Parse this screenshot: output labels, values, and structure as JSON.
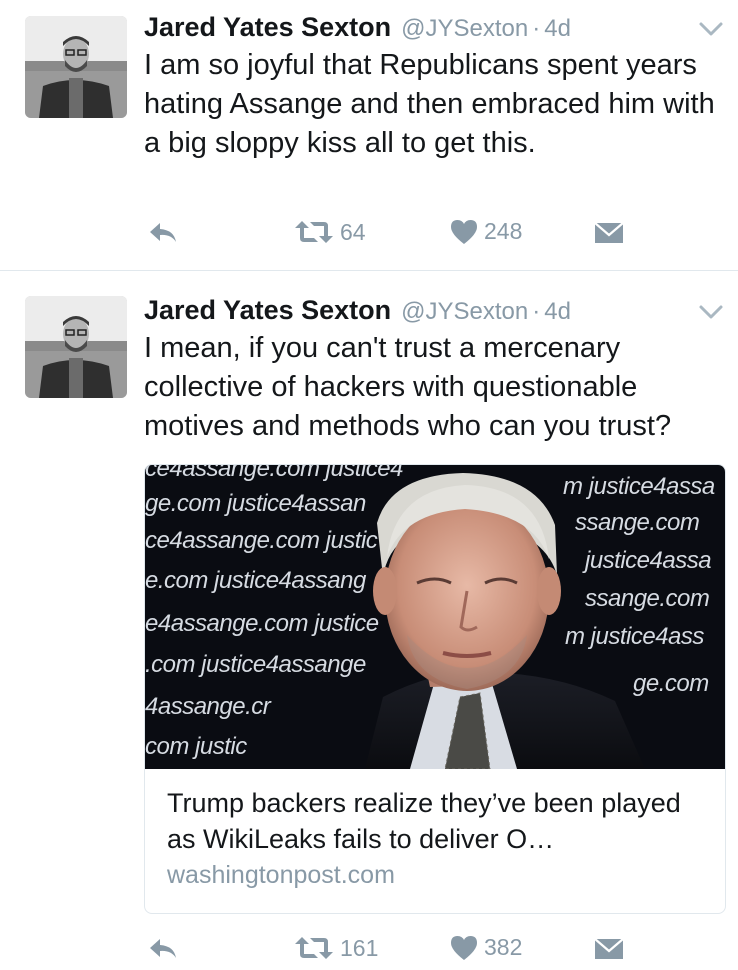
{
  "tweets": [
    {
      "author_name": "Jared Yates Sexton",
      "handle": "@JYSexton",
      "separator": "·",
      "time": "4d",
      "text": "I am so joyful that Republicans spent years hating Assange and then embraced him with a big sloppy kiss all to get this.",
      "retweets": "64",
      "likes": "248"
    },
    {
      "author_name": "Jared Yates Sexton",
      "handle": "@JYSexton",
      "separator": "·",
      "time": "4d",
      "text": "I mean, if you can't trust a mercenary collective of hackers with questionable motives and methods who can you trust?",
      "card": {
        "background_text": [
          "ce4assange.com justice4",
          "ge.com justice4assan",
          "ce4assange.com justic",
          "e.com justice4assang",
          "e4assange.com justice",
          ".com justice4assange",
          "4assange.cr",
          "com justic",
          "m justice4assa",
          "ssange.com",
          "justice4assa",
          "ssange.com",
          "m justice4ass",
          "ge.com"
        ],
        "title": "Trump backers realize they’ve been played as WikiLeaks fails to deliver O…",
        "domain": "washingtonpost.com"
      },
      "retweets": "161",
      "likes": "382"
    }
  ],
  "icons": {
    "reply": "reply-icon",
    "retweet": "retweet-icon",
    "like": "heart-icon",
    "dm": "envelope-icon",
    "more": "chevron-down-icon"
  },
  "colors": {
    "text": "#14171a",
    "muted": "#8899a6",
    "divider": "#e1e8ed"
  }
}
